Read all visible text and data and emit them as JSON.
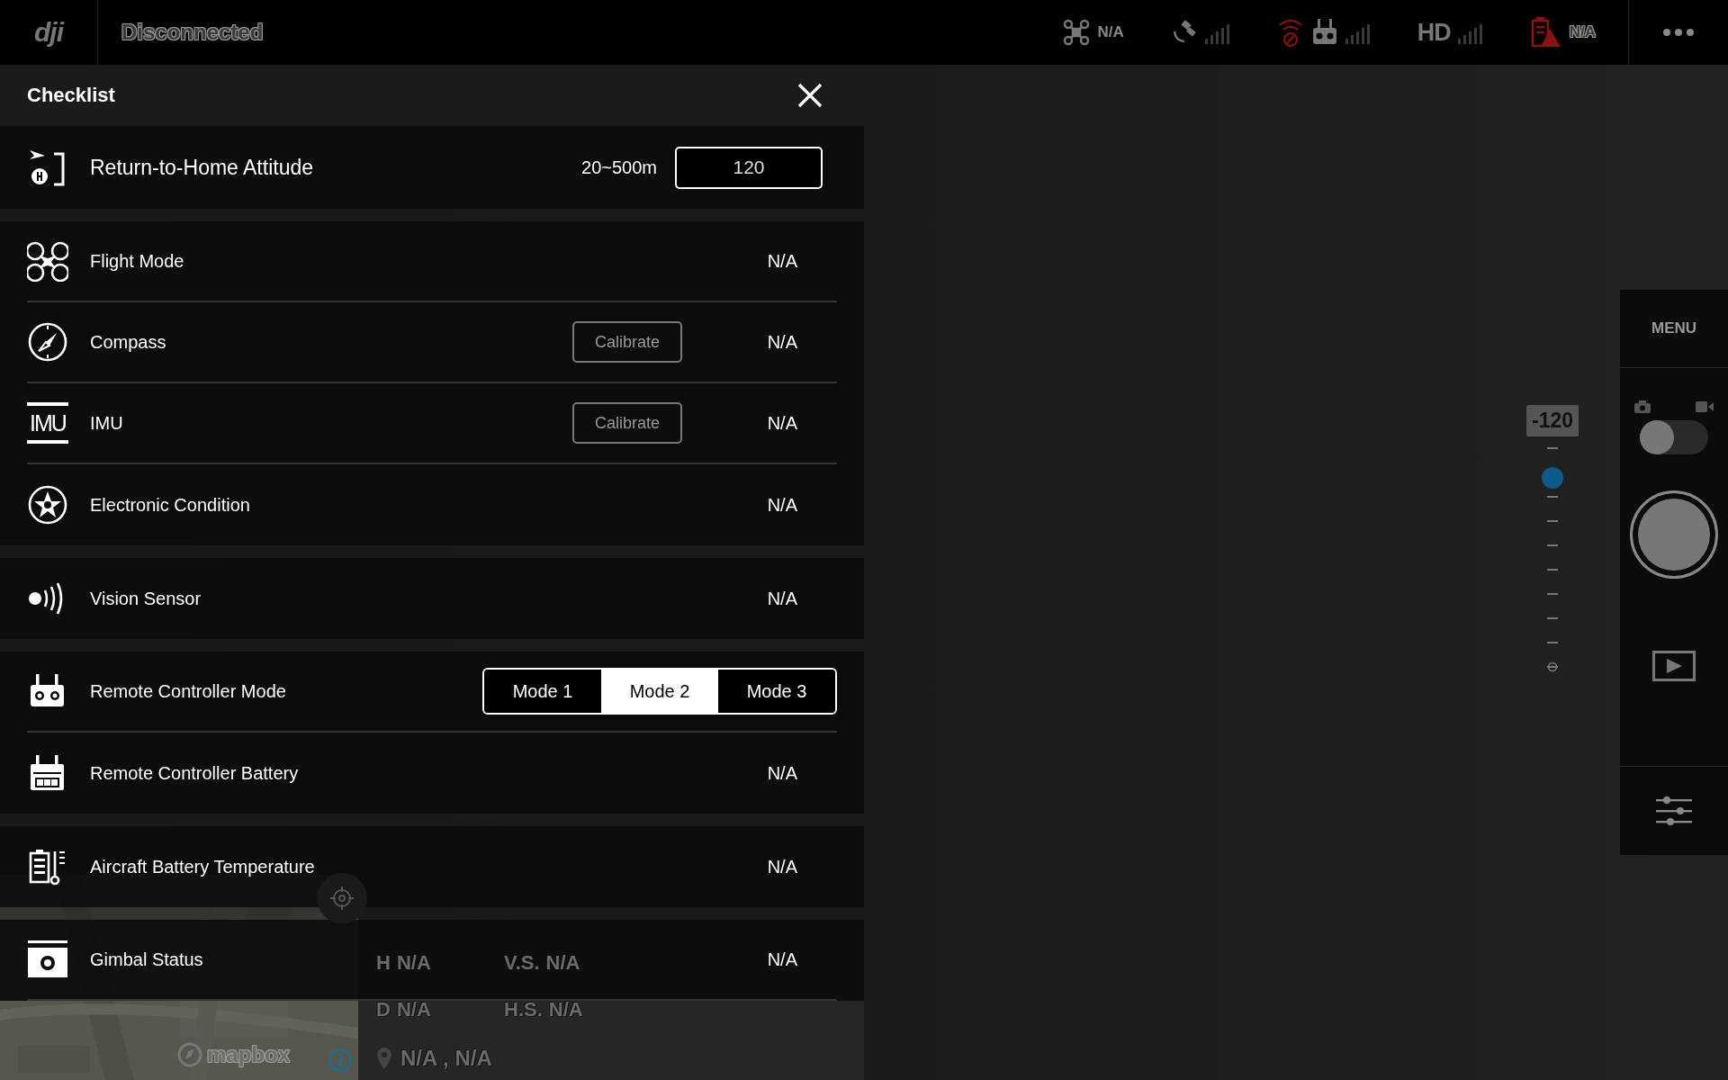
{
  "top_bar": {
    "logo": "dji",
    "connection": "Disconnected",
    "aircraft_status": "N/A",
    "video_link": "HD",
    "battery_status": "N/A"
  },
  "checklist": {
    "title": "Checklist",
    "rth": {
      "label": "Return-to-Home Attitude",
      "range": "20~500m",
      "value": "120"
    },
    "groups": [
      [
        {
          "kind": "status",
          "label": "Flight Mode",
          "value": "N/A"
        },
        {
          "kind": "calibrate",
          "label": "Compass",
          "button": "Calibrate",
          "value": "N/A"
        },
        {
          "kind": "calibrate",
          "label": "IMU",
          "icon_text": "IMU",
          "button": "Calibrate",
          "value": "N/A"
        },
        {
          "kind": "status",
          "label": "Electronic Condition",
          "value": "N/A"
        }
      ],
      [
        {
          "kind": "status",
          "label": "Vision Sensor",
          "value": "N/A"
        }
      ],
      [
        {
          "kind": "modes",
          "label": "Remote Controller Mode",
          "options": [
            {
              "label": "Mode 1",
              "selected": false
            },
            {
              "label": "Mode 2",
              "selected": true
            },
            {
              "label": "Mode 3",
              "selected": false
            }
          ]
        },
        {
          "kind": "status",
          "label": "Remote Controller Battery",
          "value": "N/A"
        }
      ],
      [
        {
          "kind": "status",
          "label": "Aircraft Battery Temperature",
          "value": "N/A"
        }
      ],
      [
        {
          "kind": "status",
          "label": "Gimbal Status",
          "value": "N/A"
        }
      ]
    ]
  },
  "telemetry": {
    "items": [
      {
        "label": "H",
        "value": "N/A"
      },
      {
        "label": "V.S.",
        "value": "N/A"
      },
      {
        "label": "D",
        "value": "N/A"
      },
      {
        "label": "H.S.",
        "value": "N/A"
      }
    ],
    "location": "N/A , N/A"
  },
  "map": {
    "kind": "picture",
    "attribution": "mapbox"
  },
  "gimbal_slider": {
    "reading": "-120",
    "level": 0.86
  },
  "camera_panel": {
    "menu": "MENU",
    "video_mode": false
  }
}
